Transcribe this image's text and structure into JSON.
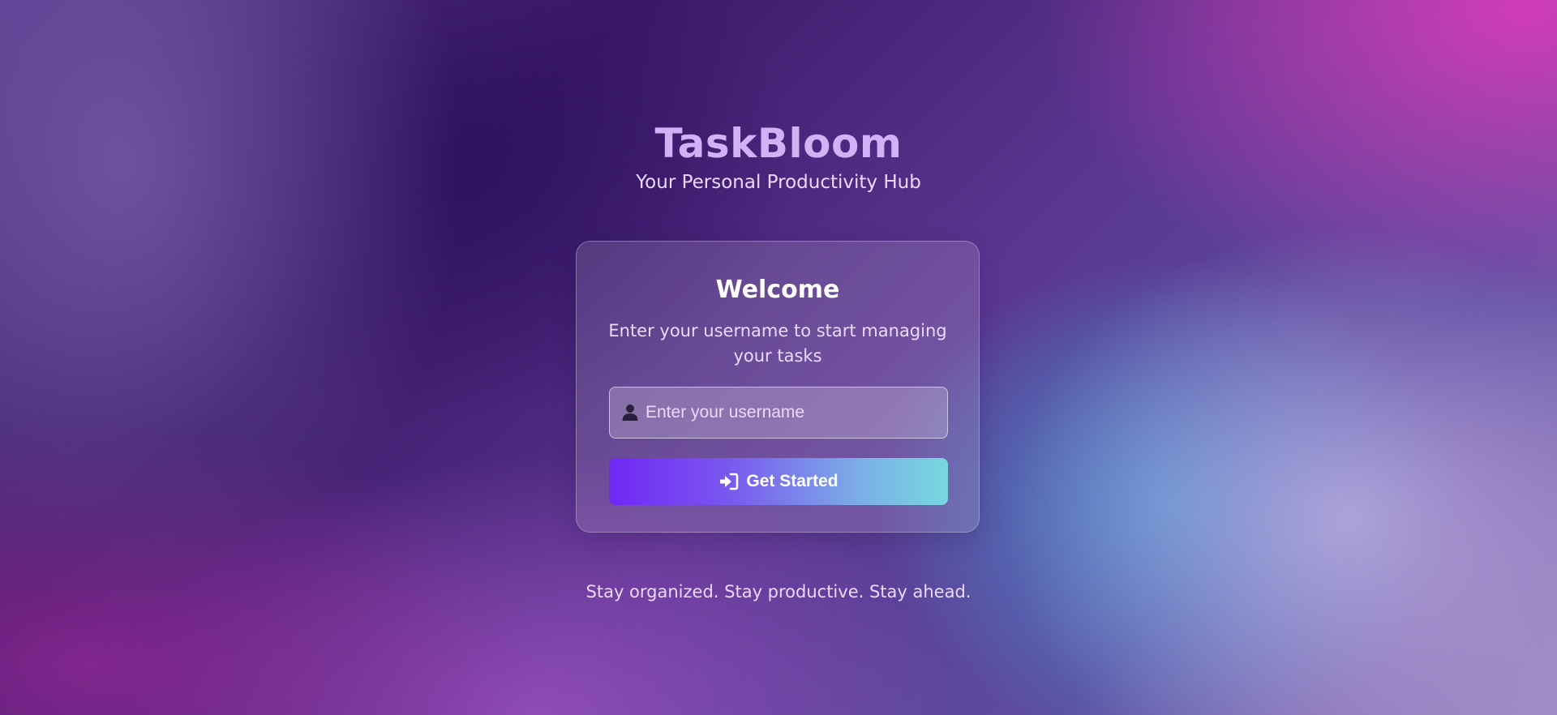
{
  "header": {
    "title": "TaskBloom",
    "subtitle": "Your Personal Productivity Hub"
  },
  "card": {
    "title": "Welcome",
    "description": "Enter your username to start managing your tasks",
    "username_input": {
      "value": "",
      "placeholder": "Enter your username",
      "icon": "user-icon"
    },
    "submit_button": {
      "label": "Get Started",
      "icon": "login-icon"
    }
  },
  "footer": {
    "tagline": "Stay organized. Stay productive. Stay ahead."
  },
  "colors": {
    "title": "#d2b2f7",
    "button_gradient_start": "#7127f5",
    "button_gradient_end": "#78d8df"
  }
}
